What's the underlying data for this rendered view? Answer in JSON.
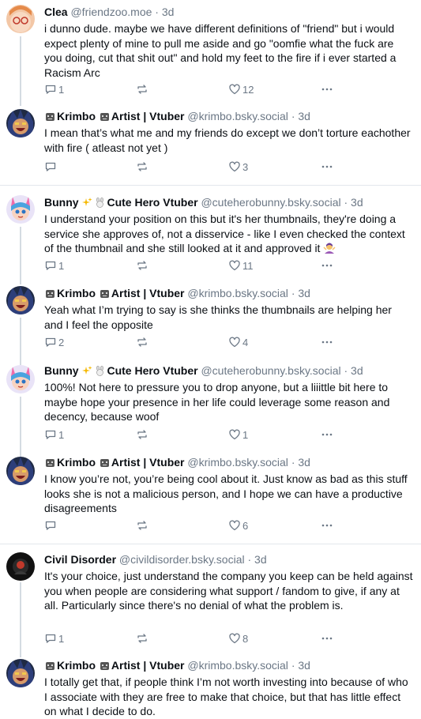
{
  "posts": [
    {
      "name": "Clea",
      "handle": "@friendzoo.moe",
      "time": "· 3d",
      "text": "i dunno dude. maybe we have different definitions of \"friend\" but i would expect plenty of mine to pull me aside and go \"oomfie what the fuck are you doing, cut that shit out\" and hold my feet to the fire if i ever started a Racism Arc",
      "reply_count": "1",
      "repost_count": "",
      "like_count": "12"
    },
    {
      "name": "Krimbo",
      "name_mid": "Artist | Vtuber",
      "handle": "@krimbo.bsky.social",
      "time": "· 3d",
      "text": "I mean that’s what me and my friends do except we don’t torture eachother with fire ( atleast not yet )",
      "reply_count": "",
      "repost_count": "",
      "like_count": "3"
    },
    {
      "name": "Bunny",
      "name_mid": "Cute Hero Vtuber",
      "handle": "@cuteherobunny.bsky.social",
      "time": "· 3d",
      "text": "I understand your position on this but it's her thumbnails, they're doing a service she approves of, not a disservice - like I even checked the context of the thumbnail and she still looked at it and approved it",
      "reply_count": "1",
      "repost_count": "",
      "like_count": "11"
    },
    {
      "name": "Krimbo",
      "name_mid": "Artist | Vtuber",
      "handle": "@krimbo.bsky.social",
      "time": "· 3d",
      "text": "Yeah what I’m trying to say is she thinks the thumbnails are helping her and I feel the opposite",
      "reply_count": "2",
      "repost_count": "",
      "like_count": "4"
    },
    {
      "name": "Bunny",
      "name_mid": "Cute Hero Vtuber",
      "handle": "@cuteherobunny.bsky.social",
      "time": "· 3d",
      "text": "100%! Not here to pressure you to drop anyone, but a liiittle bit here to maybe hope your presence in her life could leverage some reason and decency, because woof",
      "reply_count": "1",
      "repost_count": "",
      "like_count": "1"
    },
    {
      "name": "Krimbo",
      "name_mid": "Artist | Vtuber",
      "handle": "@krimbo.bsky.social",
      "time": "· 3d",
      "text": "I know you’re not, you’re being cool about it. Just know as bad as this stuff looks she is not a malicious person, and I hope we can have a productive disagreements",
      "reply_count": "",
      "repost_count": "",
      "like_count": "6"
    },
    {
      "name": "Civil Disorder",
      "handle": "@civildisorder.bsky.social",
      "time": "· 3d",
      "text": "It's your choice, just understand the company you keep can be held against you when people are considering what support / fandom to give, if any at all. Particularly since there's no denial of what the problem is.",
      "reply_count": "1",
      "repost_count": "",
      "like_count": "8"
    },
    {
      "name": "Krimbo",
      "name_mid": "Artist | Vtuber",
      "handle": "@krimbo.bsky.social",
      "time": "· 3d",
      "text": "I totally get that, if people think I’m not worth investing into because of who I associate with they are free to make that choice, but that has little effect on what I decide to do.",
      "reply_count": "",
      "repost_count": "",
      "like_count": ""
    }
  ]
}
